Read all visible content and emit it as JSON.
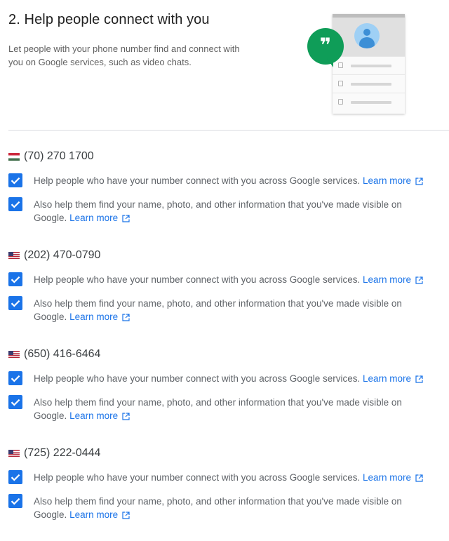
{
  "header": {
    "title": "2. Help people connect with you",
    "description": "Let people with your phone number find and connect with you on Google services, such as video chats."
  },
  "illustration": {
    "bubble_glyph": "❞"
  },
  "options": {
    "connect_text": "Help people who have your number connect with you across Google services.",
    "visible_text": "Also help them find your name, photo, and other information that you've made visible on Google.",
    "learn_more": "Learn more"
  },
  "phones": [
    {
      "number": "(70) 270 1700",
      "flag": "hungary-flag-icon",
      "connect_checked": true,
      "visible_checked": true
    },
    {
      "number": "(202) 470-0790",
      "flag": "us-flag-icon",
      "connect_checked": true,
      "visible_checked": true
    },
    {
      "number": "(650) 416-6464",
      "flag": "us-flag-icon",
      "connect_checked": true,
      "visible_checked": true
    },
    {
      "number": "(725) 222-0444",
      "flag": "us-flag-icon",
      "connect_checked": true,
      "visible_checked": true
    }
  ],
  "colors": {
    "accent": "#1a73e8",
    "hangouts_green": "#0f9d58",
    "divider": "#dadce0"
  }
}
